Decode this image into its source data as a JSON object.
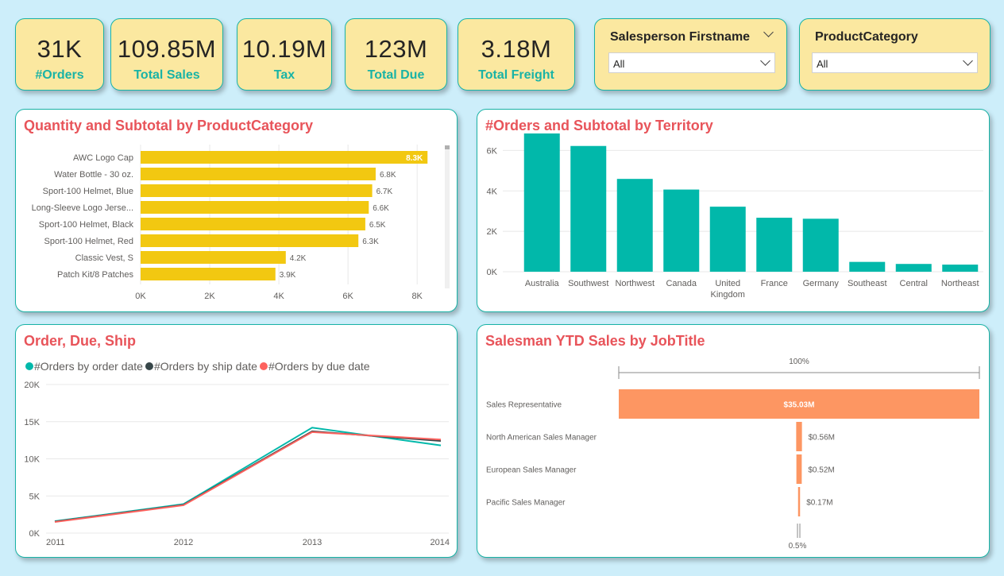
{
  "kpis": [
    {
      "value": "31K",
      "label": "#Orders"
    },
    {
      "value": "109.85M",
      "label": "Total Sales"
    },
    {
      "value": "10.19M",
      "label": "Tax"
    },
    {
      "value": "123M",
      "label": "Total Due"
    },
    {
      "value": "3.18M",
      "label": "Total Freight"
    }
  ],
  "slicers": [
    {
      "title": "Salesperson Firstname",
      "value": "All"
    },
    {
      "title": "ProductCategory",
      "value": "All"
    }
  ],
  "colors": {
    "accent": "#19b3a6",
    "title": "#e8545a",
    "kpi_bg": "#fbe8a0",
    "bar_yellow": "#f2c811",
    "bar_teal": "#01b8aa",
    "bar_orange": "#fd9662",
    "line_dark": "#374649",
    "line_red": "#fd625e"
  },
  "chart_data": [
    {
      "type": "bar",
      "orientation": "horizontal",
      "title": "Quantity and Subtotal by ProductCategory",
      "categories": [
        "AWC Logo Cap",
        "Water Bottle - 30 oz.",
        "Sport-100 Helmet, Blue",
        "Long-Sleeve Logo Jerse...",
        "Sport-100 Helmet, Black",
        "Sport-100 Helmet, Red",
        "Classic Vest, S",
        "Patch Kit/8 Patches"
      ],
      "values": [
        8300,
        6800,
        6700,
        6600,
        6500,
        6300,
        4200,
        3900
      ],
      "value_labels": [
        "8.3K",
        "6.8K",
        "6.7K",
        "6.6K",
        "6.5K",
        "6.3K",
        "4.2K",
        "3.9K"
      ],
      "xticks": [
        "0K",
        "2K",
        "4K",
        "6K",
        "8K"
      ],
      "xlim": [
        0,
        8800
      ],
      "grid": true
    },
    {
      "type": "bar",
      "title": "#Orders and Subtotal by Territory",
      "categories": [
        "Australia",
        "Southwest",
        "Northwest",
        "Canada",
        "United Kingdom",
        "France",
        "Germany",
        "Southeast",
        "Central",
        "Northeast"
      ],
      "values": [
        6843,
        6224,
        4594,
        4067,
        3219,
        2672,
        2623,
        486,
        385,
        352
      ],
      "yticks": [
        "0K",
        "2K",
        "4K",
        "6K"
      ],
      "ylim": [
        0,
        7000
      ],
      "grid": true
    },
    {
      "type": "line",
      "title": "Order, Due, Ship",
      "x": [
        "2011",
        "2012",
        "2013",
        "2014"
      ],
      "series": [
        {
          "name": "#Orders by order date",
          "values": [
            1600,
            3900,
            14200,
            11800
          ]
        },
        {
          "name": "#Orders by ship date",
          "values": [
            1550,
            3800,
            13700,
            12400
          ]
        },
        {
          "name": "#Orders by due date",
          "values": [
            1500,
            3750,
            13600,
            12600
          ]
        }
      ],
      "yticks": [
        "0K",
        "5K",
        "10K",
        "15K",
        "20K"
      ],
      "ylim": [
        0,
        20000
      ],
      "legend": "top-left",
      "grid": true
    },
    {
      "type": "bar",
      "subtype": "funnel",
      "title": "Salesman YTD Sales by JobTitle",
      "categories": [
        "Sales Representative",
        "North American Sales Manager",
        "European Sales Manager",
        "Pacific Sales Manager"
      ],
      "values": [
        35.03,
        0.56,
        0.52,
        0.17
      ],
      "value_labels": [
        "$35.03M",
        "$0.56M",
        "$0.52M",
        "$0.17M"
      ],
      "top_label": "100%",
      "bottom_label": "0.5%"
    }
  ]
}
